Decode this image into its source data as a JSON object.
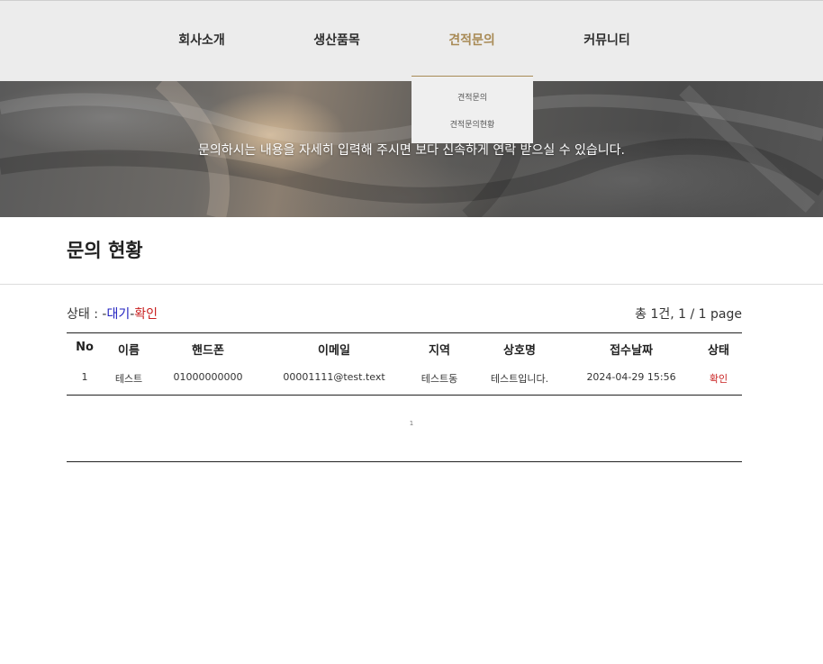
{
  "nav": {
    "items": [
      {
        "label": "회사소개"
      },
      {
        "label": "생산품목"
      },
      {
        "label": "견적문의"
      },
      {
        "label": "커뮤니티"
      }
    ],
    "active_index": 2,
    "active_color": "#a88a55"
  },
  "dropdown": {
    "items": [
      {
        "label": "견적문의"
      },
      {
        "label": "견적문의현황"
      }
    ]
  },
  "hero": {
    "text": "문의하시는 내용을 자세히 입력해 주시면 보다 신속하게 연락 받으실 수 있습니다."
  },
  "page": {
    "title": "문의 현황"
  },
  "status_legend": {
    "prefix": "상태 : ",
    "dash1": "-",
    "wait": "대기",
    "dash2": "-",
    "ok": "확인",
    "wait_color": "#1f1fbf",
    "ok_color": "#c81e1e"
  },
  "count": {
    "text": "총 1건, 1 / 1 page"
  },
  "table": {
    "headers": [
      "No",
      "이름",
      "핸드폰",
      "이메일",
      "지역",
      "상호명",
      "접수날짜",
      "상태"
    ],
    "rows": [
      {
        "no": "1",
        "name": "테스트",
        "phone": "01000000000",
        "email": "00001111@test.text",
        "region": "테스트동",
        "company": "테스트입니다.",
        "date": "2024-04-29 15:56",
        "status": "확인"
      }
    ]
  },
  "pagination": {
    "current": "1"
  }
}
